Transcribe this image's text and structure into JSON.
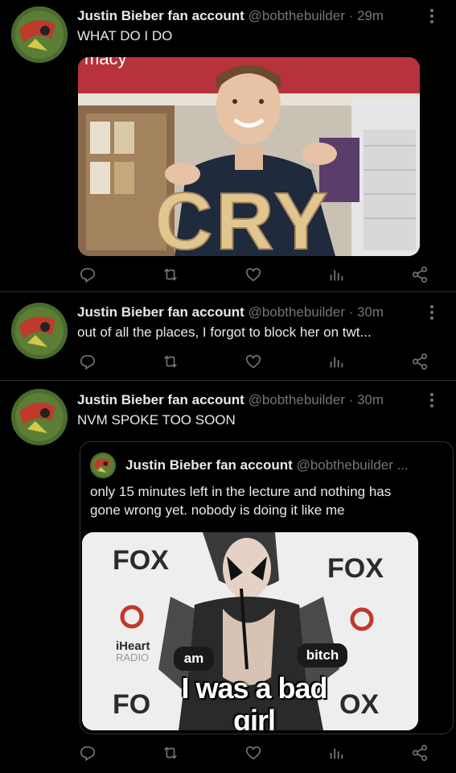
{
  "tweets": [
    {
      "name": "Justin Bieber fan account",
      "handle": "@bobthebuilder",
      "time": "· 29m",
      "text": "WHAT DO I DO",
      "media": {
        "sign_text": "macy",
        "letters": "CRY"
      }
    },
    {
      "name": "Justin Bieber fan account",
      "handle": "@bobthebuilder",
      "time": "· 30m",
      "text": "out of all the places, I forgot to block her on twt..."
    },
    {
      "name": "Justin Bieber fan account",
      "handle": "@bobthebuilder",
      "time": "· 30m",
      "text": "NVM SPOKE TOO SOON",
      "quote": {
        "name": "Justin Bieber fan account",
        "handle": "@bobthebuilder ...",
        "text": "only 15 minutes left in the lecture and nothing has gone wrong yet. nobody is doing it like me",
        "media": {
          "logo_left": "FOX",
          "logo_right": "FOX",
          "logo_bottom_left": "FO",
          "logo_bottom_right": "OX",
          "iheart": "iHeart",
          "radio": "RADIO",
          "label_am": "am",
          "label_bitch": "bitch",
          "caption": "I was a bad girl"
        }
      }
    }
  ],
  "colors": {
    "background": "#000000",
    "text": "#e7e9ea",
    "secondary": "#71767b",
    "divider": "#2f3336"
  },
  "icons": [
    "reply-icon",
    "retweet-icon",
    "like-icon",
    "views-icon",
    "share-icon",
    "more-icon"
  ]
}
